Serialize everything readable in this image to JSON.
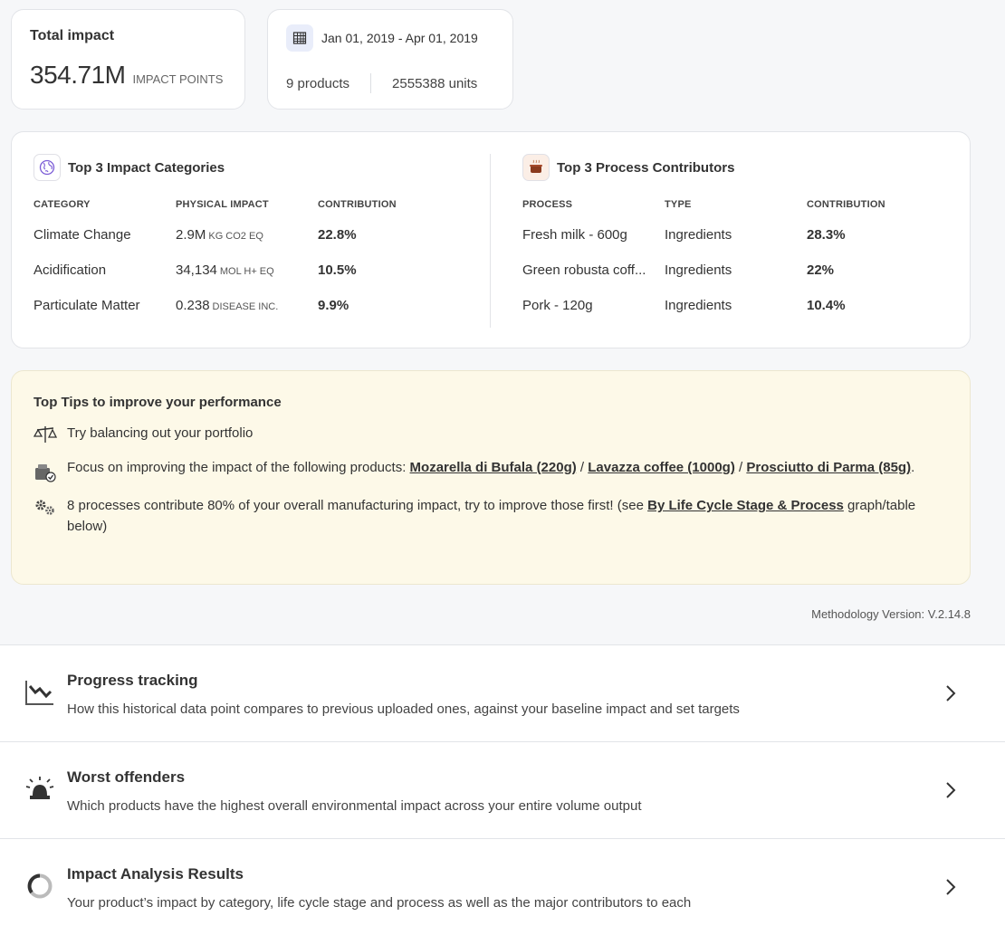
{
  "total": {
    "label": "Total impact",
    "value": "354.71M",
    "unit": "IMPACT POINTS"
  },
  "period": {
    "date_range": "Jan 01, 2019 - Apr 01, 2019",
    "products": "9 products",
    "units": "2555388 units",
    "icon": "calendar-grid-icon"
  },
  "categories": {
    "title": "Top 3 Impact Categories",
    "icon": "globe-icon",
    "headers": [
      "CATEGORY",
      "PHYSICAL IMPACT",
      "CONTRIBUTION"
    ],
    "rows": [
      {
        "name": "Climate Change",
        "value": "2.9M",
        "unit": "KG CO2 EQ",
        "contribution": "22.8%"
      },
      {
        "name": "Acidification",
        "value": "34,134",
        "unit": "MOL H+ EQ",
        "contribution": "10.5%"
      },
      {
        "name": "Particulate Matter",
        "value": "0.238",
        "unit": "DISEASE INC.",
        "contribution": "9.9%"
      }
    ]
  },
  "processes": {
    "title": "Top 3 Process Contributors",
    "icon": "cooking-pot-icon",
    "headers": [
      "PROCESS",
      "TYPE",
      "CONTRIBUTION"
    ],
    "rows": [
      {
        "name": "Fresh milk - 600g",
        "type": "Ingredients",
        "contribution": "28.3%"
      },
      {
        "name": "Green robusta coff...",
        "type": "Ingredients",
        "contribution": "22%"
      },
      {
        "name": "Pork - 120g",
        "type": "Ingredients",
        "contribution": "10.4%"
      }
    ]
  },
  "tips": {
    "title": "Top Tips to improve your performance",
    "tip1": "Try balancing out your portfolio",
    "tip2_prefix": "Focus on improving the impact of the following products: ",
    "tip2_links": [
      "Mozarella di Bufala (220g)",
      "Lavazza coffee (1000g)",
      "Prosciutto di Parma (85g)"
    ],
    "tip2_sep": " / ",
    "tip2_suffix": ".",
    "tip3_prefix": "8 processes contribute 80% of your overall manufacturing impact, try to improve those first! (see ",
    "tip3_link": "By Life Cycle Stage & Process",
    "tip3_suffix": " graph/table below)"
  },
  "methodology": "Methodology Version: V.2.14.8",
  "sections": [
    {
      "title": "Progress tracking",
      "desc": "How this historical data point compares to previous uploaded ones, against your baseline impact and set targets",
      "icon": "trend-chart-icon"
    },
    {
      "title": "Worst offenders",
      "desc": "Which products have the highest overall environmental impact across your entire volume output",
      "icon": "siren-icon"
    },
    {
      "title": "Impact Analysis Results",
      "desc": "Your product’s impact by category, life cycle stage and process as well as the major contributors to each",
      "icon": "ring-progress-icon"
    }
  ],
  "colors": {
    "tips_bg": "#fdf9e8",
    "calendar_bg": "#e9edfa",
    "globe_accent": "#7b5cd6",
    "pot_accent": "#8a3a1e"
  }
}
